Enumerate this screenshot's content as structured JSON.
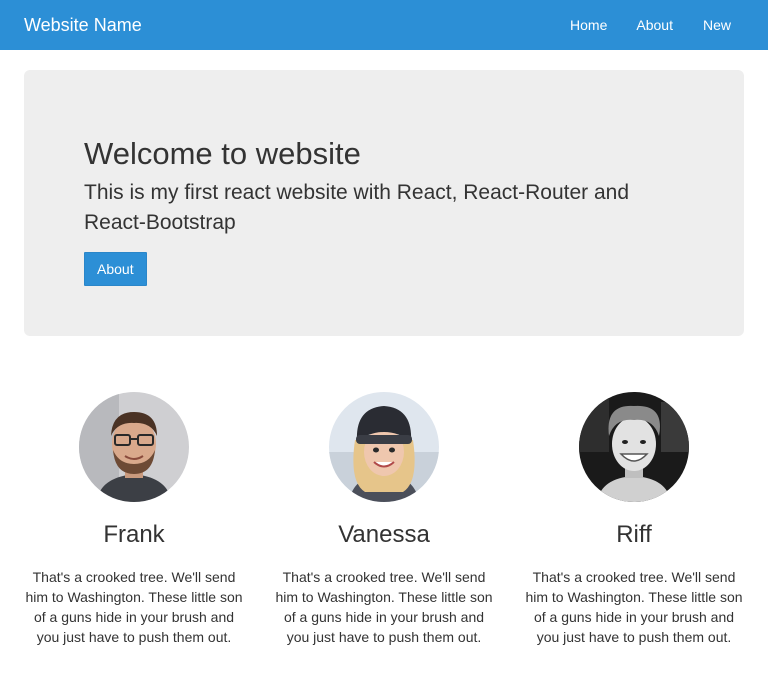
{
  "navbar": {
    "brand": "Website Name",
    "links": [
      "Home",
      "About",
      "New"
    ],
    "color": "#2c8fd6"
  },
  "hero": {
    "title": "Welcome to website",
    "subtitle": "This is my first react website with React, React-Router and React-Bootstrap",
    "button": "About"
  },
  "people": [
    {
      "name": "Frank",
      "bio": "That's a crooked tree. We'll send him to Washington. These little son of a guns hide in your brush and you just have to push them out."
    },
    {
      "name": "Vanessa",
      "bio": "That's a crooked tree. We'll send him to Washington. These little son of a guns hide in your brush and you just have to push them out."
    },
    {
      "name": "Riff",
      "bio": "That's a crooked tree. We'll send him to Washington. These little son of a guns hide in your brush and you just have to push them out."
    }
  ]
}
